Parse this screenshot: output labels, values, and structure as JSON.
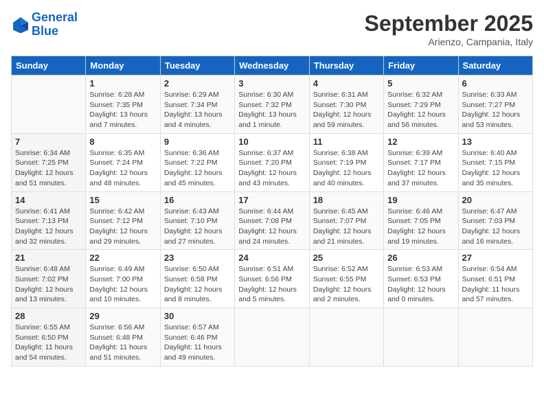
{
  "header": {
    "logo_line1": "General",
    "logo_line2": "Blue",
    "month": "September 2025",
    "location": "Arienzo, Campania, Italy"
  },
  "weekdays": [
    "Sunday",
    "Monday",
    "Tuesday",
    "Wednesday",
    "Thursday",
    "Friday",
    "Saturday"
  ],
  "weeks": [
    [
      {
        "num": "",
        "detail": ""
      },
      {
        "num": "1",
        "detail": "Sunrise: 6:28 AM\nSunset: 7:35 PM\nDaylight: 13 hours\nand 7 minutes."
      },
      {
        "num": "2",
        "detail": "Sunrise: 6:29 AM\nSunset: 7:34 PM\nDaylight: 13 hours\nand 4 minutes."
      },
      {
        "num": "3",
        "detail": "Sunrise: 6:30 AM\nSunset: 7:32 PM\nDaylight: 13 hours\nand 1 minute."
      },
      {
        "num": "4",
        "detail": "Sunrise: 6:31 AM\nSunset: 7:30 PM\nDaylight: 12 hours\nand 59 minutes."
      },
      {
        "num": "5",
        "detail": "Sunrise: 6:32 AM\nSunset: 7:29 PM\nDaylight: 12 hours\nand 56 minutes."
      },
      {
        "num": "6",
        "detail": "Sunrise: 6:33 AM\nSunset: 7:27 PM\nDaylight: 12 hours\nand 53 minutes."
      }
    ],
    [
      {
        "num": "7",
        "detail": "Sunrise: 6:34 AM\nSunset: 7:25 PM\nDaylight: 12 hours\nand 51 minutes."
      },
      {
        "num": "8",
        "detail": "Sunrise: 6:35 AM\nSunset: 7:24 PM\nDaylight: 12 hours\nand 48 minutes."
      },
      {
        "num": "9",
        "detail": "Sunrise: 6:36 AM\nSunset: 7:22 PM\nDaylight: 12 hours\nand 45 minutes."
      },
      {
        "num": "10",
        "detail": "Sunrise: 6:37 AM\nSunset: 7:20 PM\nDaylight: 12 hours\nand 43 minutes."
      },
      {
        "num": "11",
        "detail": "Sunrise: 6:38 AM\nSunset: 7:19 PM\nDaylight: 12 hours\nand 40 minutes."
      },
      {
        "num": "12",
        "detail": "Sunrise: 6:39 AM\nSunset: 7:17 PM\nDaylight: 12 hours\nand 37 minutes."
      },
      {
        "num": "13",
        "detail": "Sunrise: 6:40 AM\nSunset: 7:15 PM\nDaylight: 12 hours\nand 35 minutes."
      }
    ],
    [
      {
        "num": "14",
        "detail": "Sunrise: 6:41 AM\nSunset: 7:13 PM\nDaylight: 12 hours\nand 32 minutes."
      },
      {
        "num": "15",
        "detail": "Sunrise: 6:42 AM\nSunset: 7:12 PM\nDaylight: 12 hours\nand 29 minutes."
      },
      {
        "num": "16",
        "detail": "Sunrise: 6:43 AM\nSunset: 7:10 PM\nDaylight: 12 hours\nand 27 minutes."
      },
      {
        "num": "17",
        "detail": "Sunrise: 6:44 AM\nSunset: 7:08 PM\nDaylight: 12 hours\nand 24 minutes."
      },
      {
        "num": "18",
        "detail": "Sunrise: 6:45 AM\nSunset: 7:07 PM\nDaylight: 12 hours\nand 21 minutes."
      },
      {
        "num": "19",
        "detail": "Sunrise: 6:46 AM\nSunset: 7:05 PM\nDaylight: 12 hours\nand 19 minutes."
      },
      {
        "num": "20",
        "detail": "Sunrise: 6:47 AM\nSunset: 7:03 PM\nDaylight: 12 hours\nand 16 minutes."
      }
    ],
    [
      {
        "num": "21",
        "detail": "Sunrise: 6:48 AM\nSunset: 7:02 PM\nDaylight: 12 hours\nand 13 minutes."
      },
      {
        "num": "22",
        "detail": "Sunrise: 6:49 AM\nSunset: 7:00 PM\nDaylight: 12 hours\nand 10 minutes."
      },
      {
        "num": "23",
        "detail": "Sunrise: 6:50 AM\nSunset: 6:58 PM\nDaylight: 12 hours\nand 8 minutes."
      },
      {
        "num": "24",
        "detail": "Sunrise: 6:51 AM\nSunset: 6:56 PM\nDaylight: 12 hours\nand 5 minutes."
      },
      {
        "num": "25",
        "detail": "Sunrise: 6:52 AM\nSunset: 6:55 PM\nDaylight: 12 hours\nand 2 minutes."
      },
      {
        "num": "26",
        "detail": "Sunrise: 6:53 AM\nSunset: 6:53 PM\nDaylight: 12 hours\nand 0 minutes."
      },
      {
        "num": "27",
        "detail": "Sunrise: 6:54 AM\nSunset: 6:51 PM\nDaylight: 11 hours\nand 57 minutes."
      }
    ],
    [
      {
        "num": "28",
        "detail": "Sunrise: 6:55 AM\nSunset: 6:50 PM\nDaylight: 11 hours\nand 54 minutes."
      },
      {
        "num": "29",
        "detail": "Sunrise: 6:56 AM\nSunset: 6:48 PM\nDaylight: 11 hours\nand 51 minutes."
      },
      {
        "num": "30",
        "detail": "Sunrise: 6:57 AM\nSunset: 6:46 PM\nDaylight: 11 hours\nand 49 minutes."
      },
      {
        "num": "",
        "detail": ""
      },
      {
        "num": "",
        "detail": ""
      },
      {
        "num": "",
        "detail": ""
      },
      {
        "num": "",
        "detail": ""
      }
    ]
  ]
}
